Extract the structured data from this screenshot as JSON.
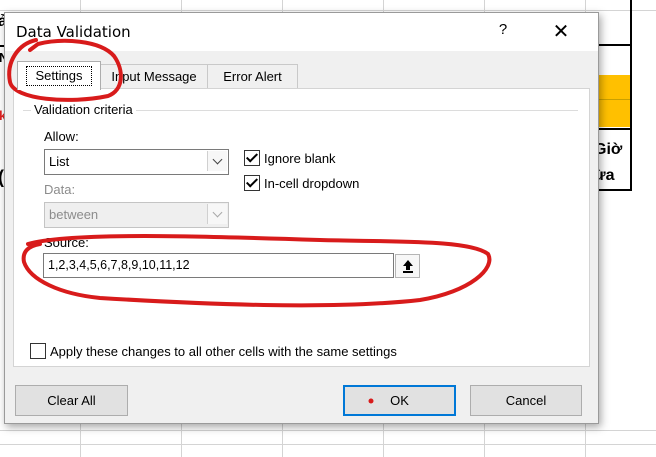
{
  "sheet": {
    "partial_texts": [
      "ả",
      "N",
      "k",
      "(",
      "Giờ",
      "ừa"
    ]
  },
  "dialog": {
    "title": "Data Validation",
    "help_glyph": "?",
    "close_glyph": "✕",
    "tabs": [
      {
        "label": "Settings",
        "active": true
      },
      {
        "label": "Input Message",
        "active": false
      },
      {
        "label": "Error Alert",
        "active": false
      }
    ],
    "criteria_heading": "Validation criteria",
    "allow": {
      "label": "Allow:",
      "value": "List"
    },
    "data": {
      "label": "Data:",
      "value": "between",
      "disabled": true
    },
    "ignore_blank": {
      "label": "Ignore blank",
      "checked": true
    },
    "in_cell_dropdown": {
      "label": "In-cell dropdown",
      "checked": true
    },
    "source": {
      "label": "Source:",
      "value": "1,2,3,4,5,6,7,8,9,10,11,12",
      "collapse_icon": "upload-arrow-icon"
    },
    "apply_all": {
      "label": "Apply these changes to all other cells with the same settings",
      "checked": false
    },
    "buttons": {
      "clear_all": "Clear All",
      "ok": "OK",
      "cancel": "Cancel"
    }
  },
  "colors": {
    "accent": "#0078d7",
    "annotation_red": "#d81b1b",
    "cell_orange": "#ffc000",
    "dialog_bg": "#f0f0f0"
  }
}
